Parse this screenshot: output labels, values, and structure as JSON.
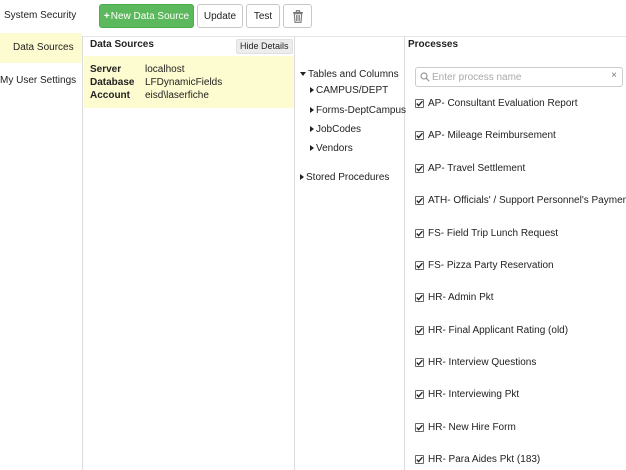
{
  "nav": {
    "items": [
      {
        "label": "System Security",
        "active": false
      },
      {
        "label": "Data Sources",
        "active": true
      },
      {
        "label": "My User Settings",
        "active": false
      }
    ]
  },
  "toolbar": {
    "new_label": "New Data Source",
    "update_label": "Update",
    "test_label": "Test",
    "delete_icon": "trash-icon"
  },
  "datasources": {
    "header": "Data Sources",
    "hide_details": "Hide Details",
    "details": [
      {
        "key": "Server",
        "value": "localhost"
      },
      {
        "key": "Database",
        "value": "LFDynamicFields"
      },
      {
        "key": "Account",
        "value": "eisd\\laserfiche"
      }
    ]
  },
  "tree": {
    "tables_label": "Tables and Columns",
    "tables": [
      "CAMPUS/DEPT",
      "Forms-DeptCampus",
      "JobCodes",
      "Vendors"
    ],
    "stored_label": "Stored Procedures"
  },
  "processes": {
    "header": "Processes",
    "search_placeholder": "Enter process name",
    "clear_label": "×",
    "items": [
      "AP- Consultant Evaluation Report",
      "AP- Mileage Reimbursement",
      "AP- Travel Settlement",
      "ATH- Officials' / Support Personnel's Payment Vo",
      "FS- Field Trip Lunch Request",
      "FS- Pizza Party Reservation",
      "HR- Admin Pkt",
      "HR- Final Applicant Rating (old)",
      "HR- Interview Questions",
      "HR- Interviewing Pkt",
      "HR- New Hire Form",
      "HR- Para Aides Pkt (183)"
    ]
  }
}
